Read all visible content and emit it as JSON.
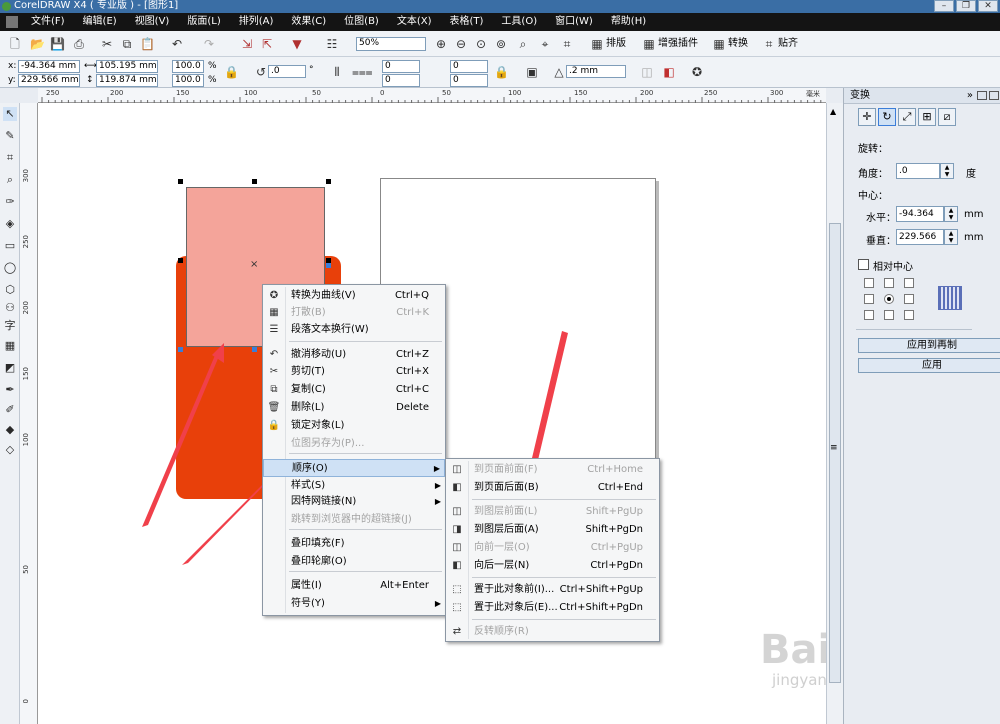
{
  "window": {
    "title": "CorelDRAW X4 ( 专业版 ) - [图形1]",
    "controls": [
      "–",
      "❐",
      "✕"
    ]
  },
  "menubar": {
    "items": [
      "文件(F)",
      "编辑(E)",
      "视图(V)",
      "版面(L)",
      "排列(A)",
      "效果(C)",
      "位图(B)",
      "文本(X)",
      "表格(T)",
      "工具(O)",
      "窗口(W)",
      "帮助(H)"
    ]
  },
  "toolbar": {
    "zoom": "50%",
    "buttons": [
      "排版",
      "增强插件",
      "转换",
      "贴齐"
    ]
  },
  "propertybar": {
    "x_label": "x:",
    "x_value": "-94.364 mm",
    "y_label": "y:",
    "y_value": "229.566 mm",
    "width_value": "105.195 mm",
    "height_value": "119.874 mm",
    "scale_x": "100.0",
    "scale_y": "100.0",
    "pct": "%",
    "rotation": ".0",
    "deg": "°",
    "corner_values": [
      "0",
      "0",
      "0",
      "0"
    ],
    "outline": ".2 mm"
  },
  "ruler": {
    "h_ticks": [
      "250",
      "200",
      "150",
      "100",
      "50",
      "0",
      "50",
      "100",
      "150",
      "200",
      "250",
      "300"
    ],
    "h_unit": "毫米",
    "v_ticks": [
      "300",
      "250",
      "200",
      "150",
      "100",
      "50",
      "0"
    ]
  },
  "context_menu": {
    "items": [
      {
        "icon": "convert-curve-icon",
        "label": "转换为曲线(V)",
        "shortcut": "Ctrl+Q",
        "disabled": false
      },
      {
        "icon": "break-apart-icon",
        "label": "打散(B)",
        "shortcut": "Ctrl+K",
        "disabled": true
      },
      {
        "icon": "paragraph-wrap-icon",
        "label": "段落文本换行(W)",
        "shortcut": "",
        "disabled": false
      },
      {
        "icon": "undo-icon",
        "label": "撤消移动(U)",
        "shortcut": "Ctrl+Z",
        "disabled": false
      },
      {
        "icon": "scissors-icon",
        "label": "剪切(T)",
        "shortcut": "Ctrl+X",
        "disabled": false
      },
      {
        "icon": "copy-icon",
        "label": "复制(C)",
        "shortcut": "Ctrl+C",
        "disabled": false
      },
      {
        "icon": "trash-icon",
        "label": "删除(L)",
        "shortcut": "Delete",
        "disabled": false
      },
      {
        "icon": "lock-icon",
        "label": "锁定对象(L)",
        "shortcut": "",
        "disabled": false
      },
      {
        "icon": "",
        "label": "位图另存为(P)...",
        "shortcut": "",
        "disabled": true
      },
      {
        "icon": "",
        "label": "顺序(O)",
        "shortcut": "",
        "disabled": false,
        "submenu": true,
        "highlighted": true
      },
      {
        "icon": "",
        "label": "样式(S)",
        "shortcut": "",
        "disabled": false,
        "submenu": true
      },
      {
        "icon": "",
        "label": "因特网链接(N)",
        "shortcut": "",
        "disabled": false,
        "submenu": true
      },
      {
        "icon": "",
        "label": "跳转到浏览器中的超链接(J)",
        "shortcut": "",
        "disabled": true
      },
      {
        "icon": "",
        "label": "叠印填充(F)",
        "shortcut": "",
        "disabled": false
      },
      {
        "icon": "",
        "label": "叠印轮廓(O)",
        "shortcut": "",
        "disabled": false
      },
      {
        "icon": "",
        "label": "属性(I)",
        "shortcut": "Alt+Enter",
        "disabled": false
      },
      {
        "icon": "",
        "label": "符号(Y)",
        "shortcut": "",
        "disabled": false,
        "submenu": true
      }
    ]
  },
  "order_submenu": {
    "items": [
      {
        "icon": "to-page-front-icon",
        "label": "到页面前面(F)",
        "shortcut": "Ctrl+Home",
        "disabled": true
      },
      {
        "icon": "to-page-back-icon",
        "label": "到页面后面(B)",
        "shortcut": "Ctrl+End",
        "disabled": false
      },
      {
        "icon": "to-layer-front-icon",
        "label": "到图层前面(L)",
        "shortcut": "Shift+PgUp",
        "disabled": true
      },
      {
        "icon": "to-layer-back-icon",
        "label": "到图层后面(A)",
        "shortcut": "Shift+PgDn",
        "disabled": false
      },
      {
        "icon": "forward-one-icon",
        "label": "向前一层(O)",
        "shortcut": "Ctrl+PgUp",
        "disabled": true
      },
      {
        "icon": "back-one-icon",
        "label": "向后一层(N)",
        "shortcut": "Ctrl+PgDn",
        "disabled": false
      },
      {
        "icon": "in-front-of-icon",
        "label": "置于此对象前(I)...",
        "shortcut": "Ctrl+Shift+PgUp",
        "disabled": false
      },
      {
        "icon": "behind-icon",
        "label": "置于此对象后(E)...",
        "shortcut": "Ctrl+Shift+PgDn",
        "disabled": false
      },
      {
        "icon": "reverse-order-icon",
        "label": "反转顺序(R)",
        "shortcut": "",
        "disabled": true
      }
    ]
  },
  "docker": {
    "title": "变换",
    "rotation_heading": "旋转：",
    "angle_label": "角度：",
    "angle_value": ".0",
    "angle_unit": "度",
    "center_heading": "中心：",
    "h_label": "水平：",
    "h_value": "-94.364",
    "h_unit": "mm",
    "v_label": "垂直：",
    "v_value": "229.566",
    "v_unit": "mm",
    "relative_center_label": "相对中心",
    "apply_to_duplicate": "应用到再制",
    "apply": "应用"
  },
  "watermark": {
    "text": "Baidu经验",
    "url": "jingyan.baidu.com"
  },
  "colors": {
    "light_rect": "#f4a49a",
    "dark_rect": "#e8400a",
    "arrow": "#f0404a",
    "menubar": "#141414",
    "titlebar": "#3a6ea5"
  }
}
